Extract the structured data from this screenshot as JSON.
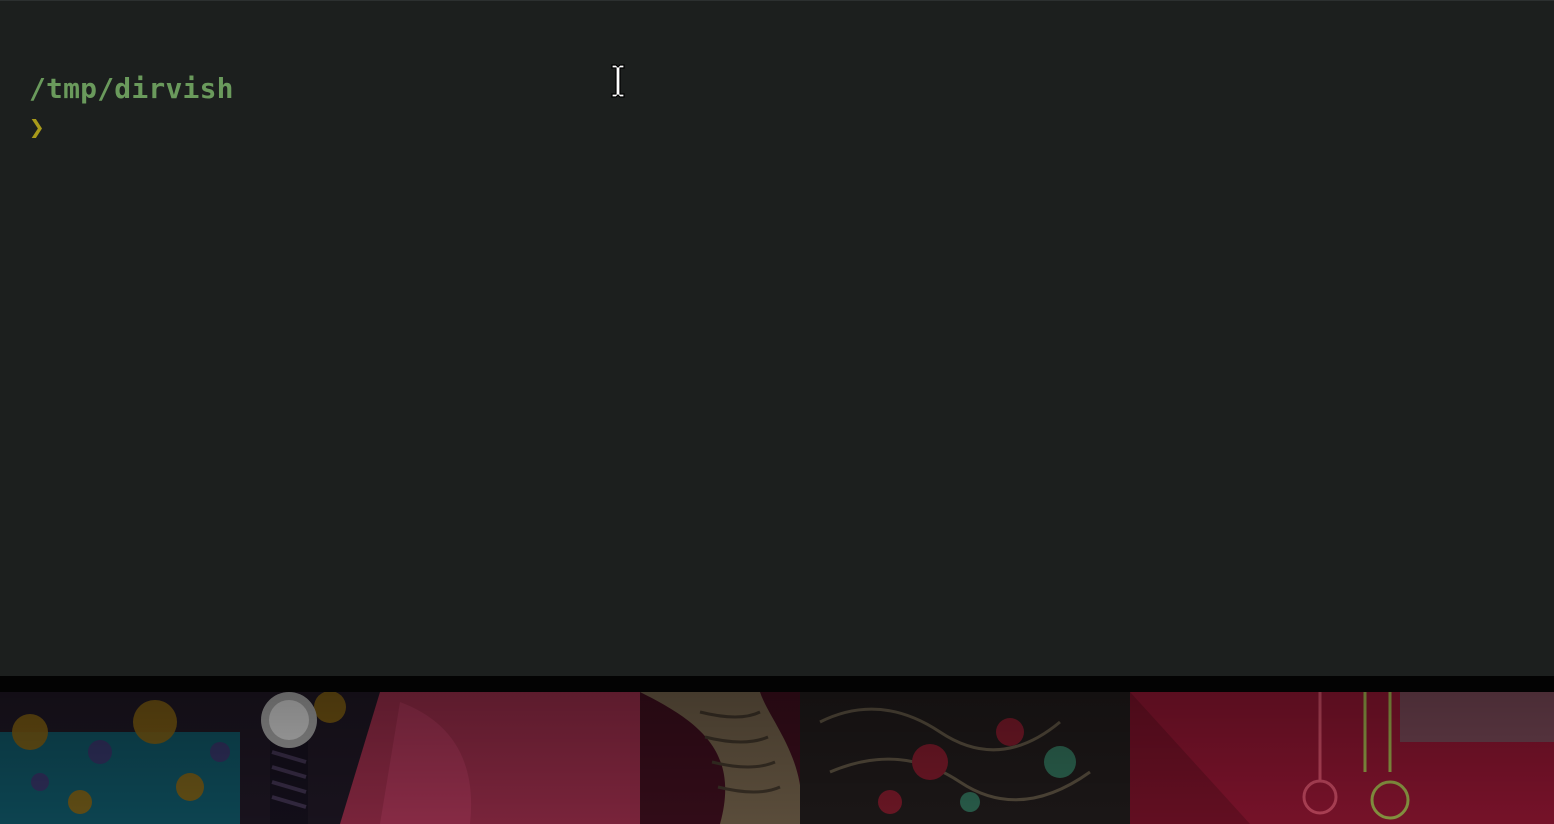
{
  "terminal": {
    "cwd_path": "/tmp/dirvish",
    "prompt_symbol": "❯",
    "colors": {
      "background": "#1c1f1e",
      "path": "#6a9a5c",
      "prompt": "#a89a1a"
    }
  },
  "cursor": {
    "type": "text-ibeam-cursor-icon"
  },
  "wallpaper": {
    "description_icon": "anime-wallpaper-image"
  }
}
